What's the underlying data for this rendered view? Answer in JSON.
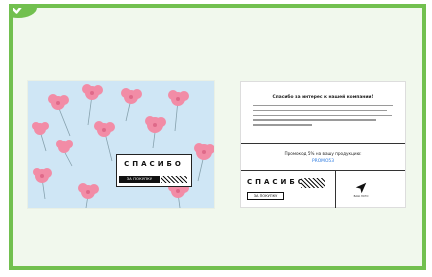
{
  "header": {
    "check_icon": "check-icon",
    "accent_color": "#72c04f",
    "panel_bg": "#f1f8ed"
  },
  "left_card": {
    "background": "#cfe6f5",
    "flower_color": "#f28ca6",
    "thanks_word": "СПАСИБО",
    "thanks_sub": "ЗА ПОКУПКУ"
  },
  "right_card": {
    "title": "Спасибо за интерес к нашей компании!",
    "promo_text": "Промокод 5% на вашу продукцию:",
    "promo_code": "PROMO53",
    "thanks_word": "СПАСИБО",
    "thanks_sub": "ЗА ПОКУПКУ",
    "logo_text": "ВАШ ЛОГО",
    "logo_icon": "send-arrow-icon"
  }
}
